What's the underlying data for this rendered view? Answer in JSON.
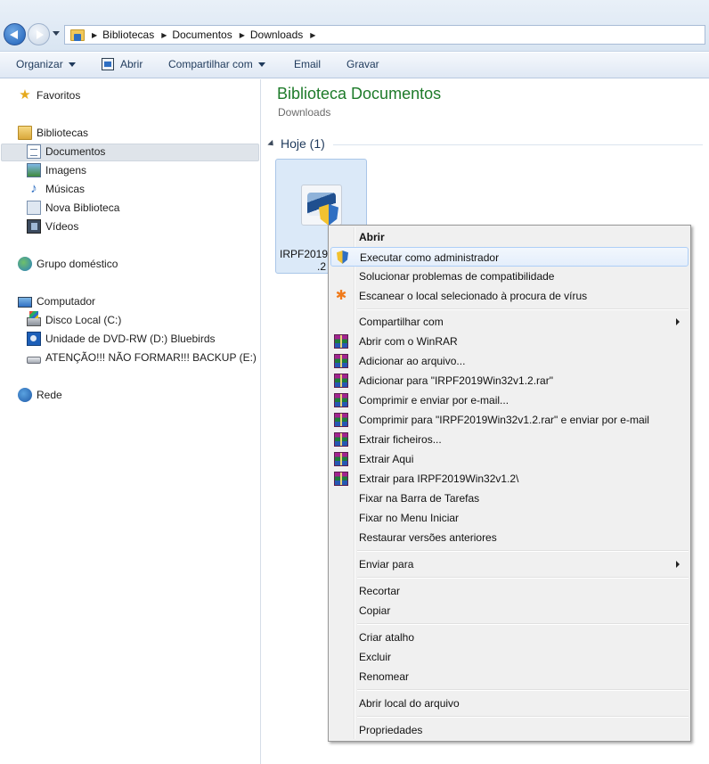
{
  "addressbar": {
    "crumbs": [
      "Bibliotecas",
      "Documentos",
      "Downloads"
    ]
  },
  "toolbar": {
    "organize": "Organizar",
    "open": "Abrir",
    "share": "Compartilhar com",
    "email": "Email",
    "burn": "Gravar"
  },
  "sidebar": {
    "favorites": "Favoritos",
    "libraries": "Bibliotecas",
    "documents": "Documentos",
    "images": "Imagens",
    "music": "Músicas",
    "new_library": "Nova Biblioteca",
    "videos": "Vídeos",
    "homegroup": "Grupo doméstico",
    "computer": "Computador",
    "local_disk": "Disco Local (C:)",
    "dvd_drive": "Unidade de DVD-RW (D:) Bluebirds",
    "usb_drive": "ATENÇÃO!!! NÃO FORMAR!!!  BACKUP (E:)",
    "network": "Rede"
  },
  "main": {
    "title": "Biblioteca Documentos",
    "subtitle": "Downloads",
    "group_header": "Hoje (1)",
    "file_name_line1": "IRPF2019W",
    "file_name_line2": ".2"
  },
  "context_menu": {
    "open": "Abrir",
    "run_as_admin": "Executar como administrador",
    "troubleshoot": "Solucionar problemas de compatibilidade",
    "scan": "Escanear o local selecionado à procura de vírus",
    "share_with": "Compartilhar com",
    "open_winrar": "Abrir com o WinRAR",
    "add_archive": "Adicionar ao arquivo...",
    "add_to_rar": "Adicionar para \"IRPF2019Win32v1.2.rar\"",
    "compress_email": "Comprimir e enviar por e-mail...",
    "compress_rar_email": "Comprimir para \"IRPF2019Win32v1.2.rar\" e enviar por e-mail",
    "extract_files": "Extrair ficheiros...",
    "extract_here": "Extrair Aqui",
    "extract_to": "Extrair para IRPF2019Win32v1.2\\",
    "pin_taskbar": "Fixar na Barra de Tarefas",
    "pin_start": "Fixar no Menu Iniciar",
    "restore_versions": "Restaurar versões anteriores",
    "send_to": "Enviar para",
    "cut": "Recortar",
    "copy": "Copiar",
    "create_shortcut": "Criar atalho",
    "delete": "Excluir",
    "rename": "Renomear",
    "open_location": "Abrir local do arquivo",
    "properties": "Propriedades"
  }
}
